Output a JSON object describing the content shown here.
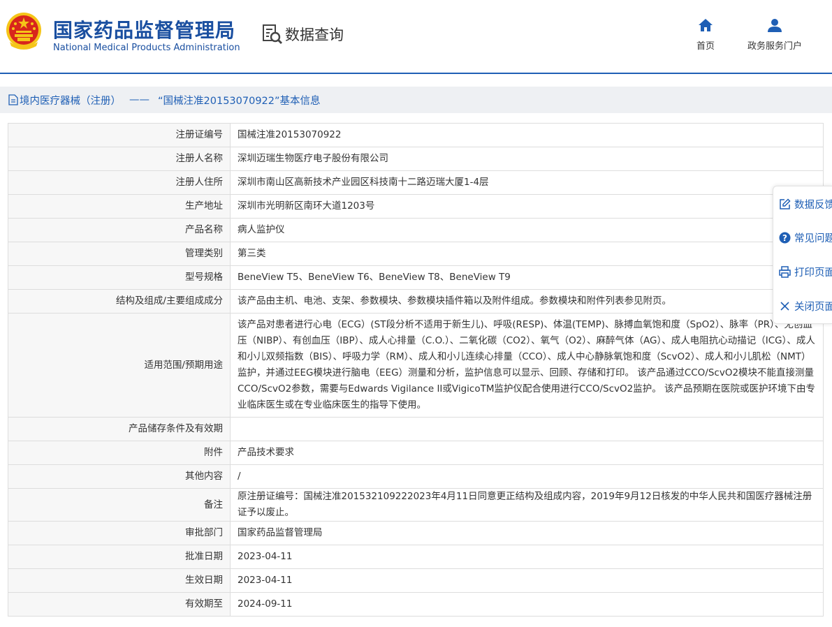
{
  "header": {
    "logo_cn": "国家药品监督管理局",
    "logo_en": "National Medical Products Administration",
    "section_title": "数据查询",
    "nav": {
      "home": "首页",
      "portal": "政务服务门户"
    }
  },
  "breadcrumb": {
    "category": "境内医疗器械（注册）",
    "separator": "——",
    "title": "“国械注准20153070922”基本信息"
  },
  "table": {
    "rows": [
      {
        "label": "注册证编号",
        "value": "国械注准20153070922"
      },
      {
        "label": "注册人名称",
        "value": "深圳迈瑞生物医疗电子股份有限公司"
      },
      {
        "label": "注册人住所",
        "value": "深圳市南山区高新技术产业园区科技南十二路迈瑞大厦1-4层"
      },
      {
        "label": "生产地址",
        "value": "深圳市光明新区南环大道1203号"
      },
      {
        "label": "产品名称",
        "value": "病人监护仪"
      },
      {
        "label": "管理类别",
        "value": "第三类"
      },
      {
        "label": "型号规格",
        "value": "BeneView T5、BeneView T6、BeneView T8、BeneView T9"
      },
      {
        "label": "结构及组成/主要组成成分",
        "value": "该产品由主机、电池、支架、参数模块、参数模块插件箱以及附件组成。参数模块和附件列表参见附页。"
      },
      {
        "label": "适用范围/预期用途",
        "value": "该产品对患者进行心电（ECG）(ST段分析不适用于新生儿)、呼吸(RESP)、体温(TEMP)、脉搏血氧饱和度（SpO2）、脉率（PR）、无创血压（NIBP）、有创血压（IBP）、成人心排量（C.O.）、二氧化碳（CO2）、氧气（O2）、麻醉气体（AG）、成人电阻抗心动描记（ICG）、成人和小儿双频指数（BIS）、呼吸力学（RM）、成人和小儿连续心排量（CCO）、成人中心静脉氧饱和度（ScvO2）、成人和小儿肌松（NMT）监护，并通过EEG模块进行脑电（EEG）测量和分析，监护信息可以显示、回顾、存储和打印。 该产品通过CCO/ScvO2模块不能直接测量CCO/ScvO2参数，需要与Edwards Vigilance II或VigicoTM监护仪配合使用进行CCO/ScvO2监护。 该产品预期在医院或医护环境下由专业临床医生或在专业临床医生的指导下使用。"
      },
      {
        "label": "产品储存条件及有效期",
        "value": ""
      },
      {
        "label": "附件",
        "value": "产品技术要求"
      },
      {
        "label": "其他内容",
        "value": "/"
      },
      {
        "label": "备注",
        "value": "原注册证编号：国械注准20153210922​2023年4月11日同意更正结构及组成内容，2019年9月12日核发的中华人民共和国医疗器械注册证予以废止。"
      },
      {
        "label": "审批部门",
        "value": "国家药品监督管理局"
      },
      {
        "label": "批准日期",
        "value": "2023-04-11"
      },
      {
        "label": "生效日期",
        "value": "2023-04-11"
      },
      {
        "label": "有效期至",
        "value": "2024-09-11"
      }
    ]
  },
  "sidetool": {
    "feedback": "数据反馈",
    "faq": "常见问题",
    "print": "打印页面",
    "close": "关闭页面"
  },
  "colors": {
    "brand": "#1f5fb5",
    "emblem_red": "#d8261c",
    "emblem_gold": "#f5c518"
  }
}
